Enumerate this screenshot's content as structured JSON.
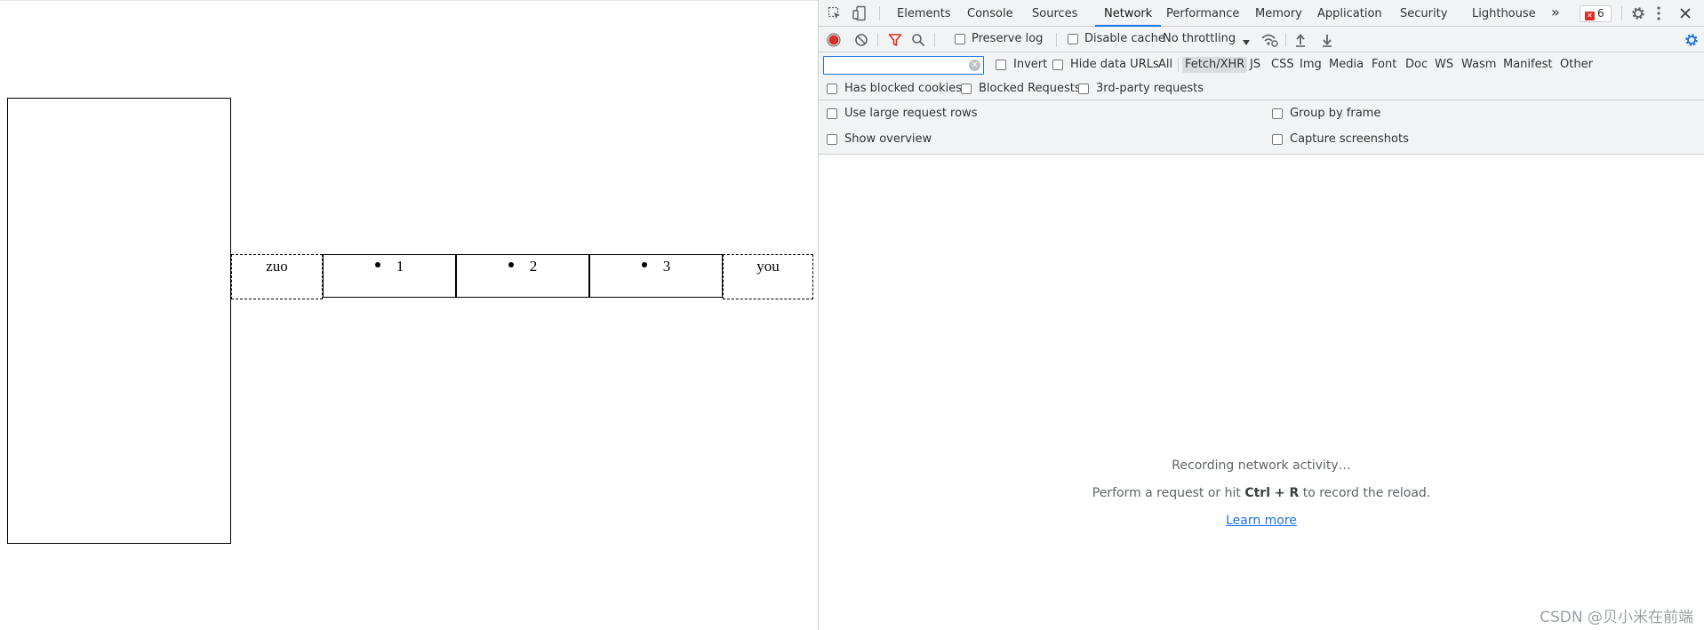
{
  "page": {
    "cells": [
      {
        "text": "zuo",
        "style": "dashed"
      },
      {
        "text": "1",
        "style": "solid",
        "bullet": true
      },
      {
        "text": "2",
        "style": "solid",
        "bullet": true
      },
      {
        "text": "3",
        "style": "solid",
        "bullet": true
      },
      {
        "text": "you",
        "style": "dashed"
      }
    ]
  },
  "devtools": {
    "tabs": [
      "Elements",
      "Console",
      "Sources",
      "Network",
      "Performance",
      "Memory",
      "Application",
      "Security",
      "Lighthouse"
    ],
    "active_tab": "Network",
    "more_tabs_glyph": "»",
    "error_count": "6",
    "toolbar": {
      "preserve_log": "Preserve log",
      "disable_cache": "Disable cache",
      "throttling": "No throttling"
    },
    "filter": {
      "value": "",
      "placeholder": "",
      "invert": "Invert",
      "hide_data_urls": "Hide data URLs",
      "types": [
        "All",
        "Fetch/XHR",
        "JS",
        "CSS",
        "Img",
        "Media",
        "Font",
        "Doc",
        "WS",
        "Wasm",
        "Manifest",
        "Other"
      ],
      "selected_type": "Fetch/XHR"
    },
    "filter2": {
      "blocked_cookies": "Has blocked cookies",
      "blocked_requests": "Blocked Requests",
      "third_party": "3rd-party requests"
    },
    "settings": {
      "large_rows": "Use large request rows",
      "group_by_frame": "Group by frame",
      "show_overview": "Show overview",
      "capture_screenshots": "Capture screenshots"
    },
    "empty": {
      "line1": "Recording network activity…",
      "line2_prefix": "Perform a request or hit ",
      "line2_keys": "Ctrl + R",
      "line2_suffix": " to record the reload.",
      "learn_more": "Learn more"
    },
    "colors": {
      "accent": "#1a73e8",
      "record": "#d93025",
      "filter_icon": "#d93025"
    }
  },
  "watermark": "CSDN @贝小米在前端"
}
